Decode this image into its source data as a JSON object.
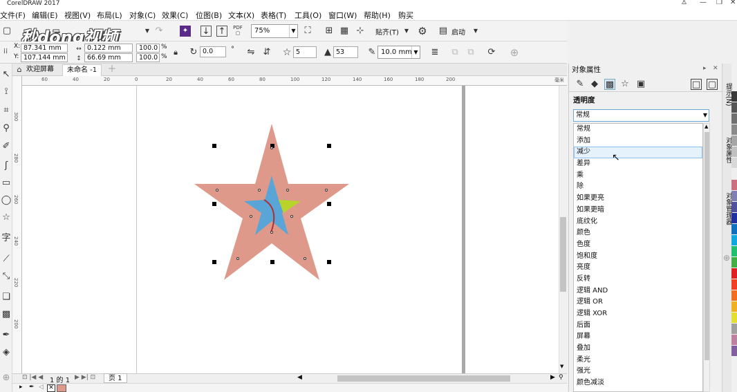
{
  "app": {
    "title": "CorelDRAW 2017"
  },
  "menu": [
    "文件(F)",
    "编辑(E)",
    "视图(V)",
    "布局(L)",
    "对象(C)",
    "效果(C)",
    "位图(B)",
    "文本(X)",
    "表格(T)",
    "工具(O)",
    "窗口(W)",
    "帮助(H)",
    "购买"
  ],
  "watermark": "秒dōng视频",
  "toolbar": {
    "zoom": "75%",
    "snap_label": "贴齐(T)",
    "launch_label": "启动"
  },
  "propbar": {
    "x_label": "X:",
    "x_value": "87.341 mm",
    "y_label": "Y:",
    "y_value": "107.144 mm",
    "w_value": "0.122 mm",
    "h_value": "66.69 mm",
    "scale_w": "100.0",
    "scale_h": "100.0",
    "pct": "%",
    "rotation": "0.0",
    "degree": "°",
    "points": "5",
    "sharpness": "53",
    "outline": "10.0 mm"
  },
  "doc_tabs": [
    "欢迎屏幕",
    "未命名 -1"
  ],
  "ruler": {
    "h_ticks": [
      "60",
      "40",
      "20",
      "0",
      "20",
      "40",
      "60",
      "80",
      "100",
      "120",
      "140",
      "160",
      "180",
      "200"
    ],
    "h_unit": "毫米",
    "v_ticks": [
      "300",
      "280",
      "260",
      "240",
      "220",
      "200"
    ]
  },
  "page_nav": {
    "label": "1 的 1",
    "page_tab": "页 1"
  },
  "panel": {
    "title": "对象属性",
    "section": "透明度",
    "mode_value": "常规",
    "options": [
      "常规",
      "添加",
      "减少",
      "差异",
      "乘",
      "除",
      "如果更亮",
      "如果更暗",
      "底纹化",
      "颜色",
      "色度",
      "饱和度",
      "亮度",
      "反转",
      "逻辑 AND",
      "逻辑 OR",
      "逻辑 XOR",
      "后面",
      "屏幕",
      "叠加",
      "柔光",
      "强光",
      "颜色减淡"
    ],
    "highlighted_index": 2
  },
  "dock": {
    "tabs": [
      "提示(N)",
      "对象属性",
      "对象管理器"
    ]
  },
  "colors": {
    "star_outer": "#de998a",
    "star_inner": "#5aa5d8",
    "accent_green": "#b8d42a",
    "curve": "#b03030"
  },
  "palette": [
    "#3a3a3a",
    "#555555",
    "#707070",
    "#8a8a8a",
    "#a5a5a5",
    "#c0c0c0",
    "#d8d8d8",
    "#eeeeee",
    "#cc7080",
    "#8080b0",
    "#5050a0",
    "#2030a0",
    "#1070c0",
    "#10a8e0",
    "#20c070",
    "#40b040",
    "#e02020",
    "#f04020",
    "#f07020",
    "#f0b020",
    "#e0e030",
    "#a0a0a0",
    "#c080a0",
    "#8060a0"
  ]
}
